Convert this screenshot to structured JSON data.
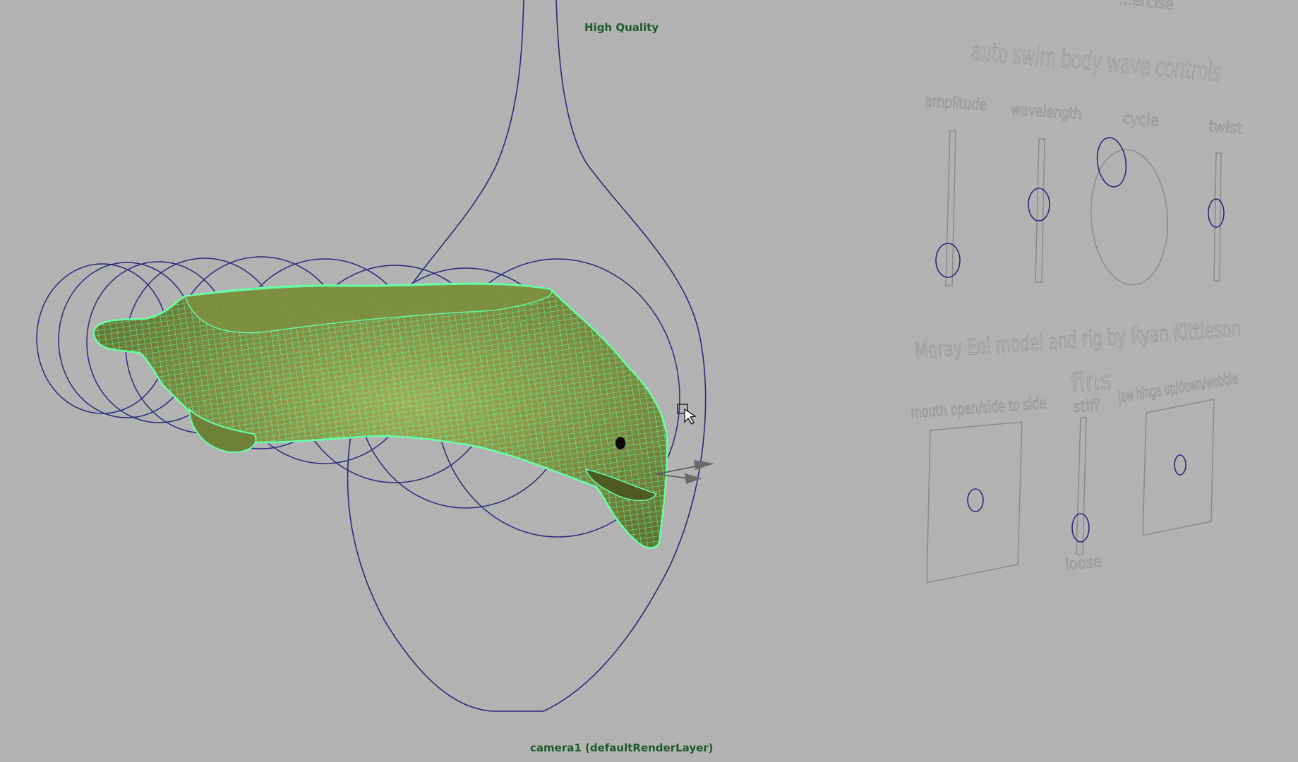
{
  "viewport": {
    "hud_quality": "High Quality",
    "hud_camera": "camera1 (defaultRenderLayer)"
  },
  "panel": {
    "top_cut_label": "...ercise",
    "swim_title": "auto swim body wave controls",
    "amplitude_label": "amplitude",
    "wavelength_label": "wavelength",
    "cycle_label": "cycle",
    "twist_label": "twist",
    "credit": "Moray Eel model and rig by Ryan Kittleson",
    "mouth_label": "mouth open/side to side",
    "fins_label": "fins",
    "stiff_label": "stiff",
    "loose_label": "loose",
    "jaw_label": "jaw hinge up/down/wobble"
  },
  "colors": {
    "background": "#b2b2b2",
    "curve": "#2a2a7a",
    "mesh_fill": "#7a8a3e",
    "wire_select": "#66ffa8",
    "hud_text": "#1e5a2a",
    "panel_outline": "#8a8a8a"
  }
}
